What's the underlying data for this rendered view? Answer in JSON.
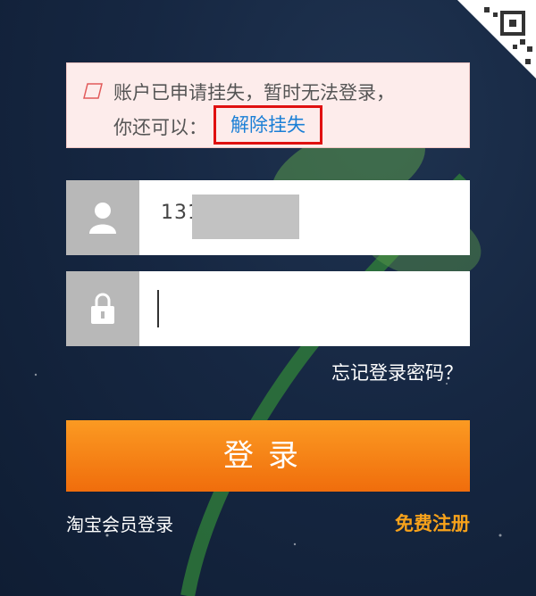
{
  "alert": {
    "line1": "账户已申请挂失，暂时无法登录，",
    "line2_prefix": "你还可以：",
    "unlock_link": "解除挂失"
  },
  "username": {
    "value": "131",
    "icon": "user-icon"
  },
  "password": {
    "value": "",
    "icon": "lock-icon"
  },
  "forgot_link": "忘记登录密码？",
  "login_button": "登录",
  "member_login_link": "淘宝会员登录",
  "register_link": "免费注册",
  "colors": {
    "accent_orange": "#f7931e",
    "link_blue": "#1a7fd6",
    "highlight_red": "#e01010",
    "register_orange": "#f7a21b"
  }
}
